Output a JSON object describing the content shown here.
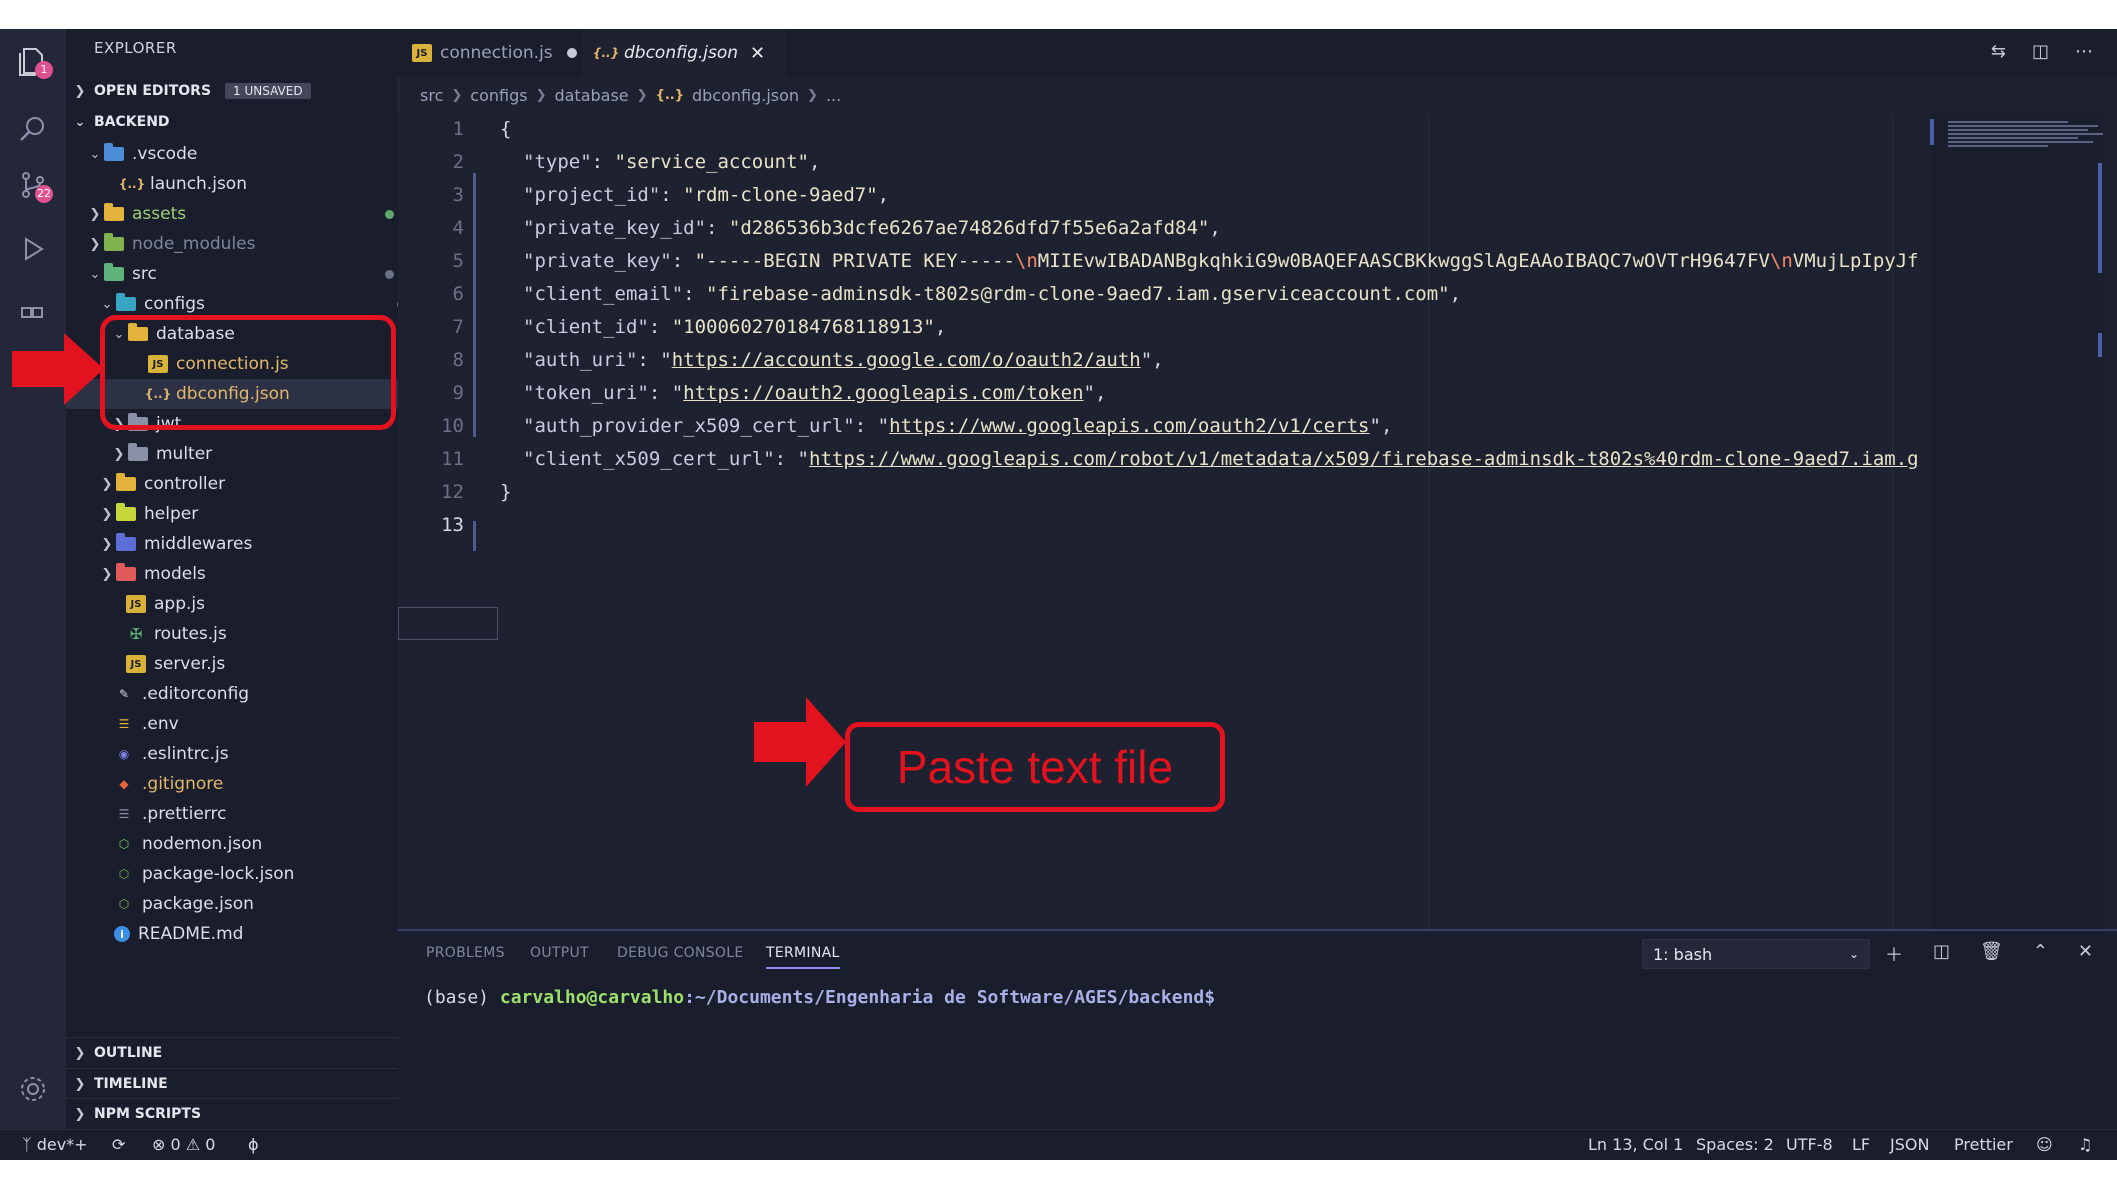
{
  "explorer": {
    "title": "EXPLORER",
    "open_editors": "OPEN EDITORS",
    "unsaved_badge": "1 UNSAVED",
    "project": "BACKEND",
    "tree": [
      {
        "label": "vscode_item",
        "text": ".vscode"
      },
      {
        "text": "launch.json"
      },
      {
        "text": "assets"
      },
      {
        "text": "node_modules"
      },
      {
        "text": "src"
      },
      {
        "text": "configs"
      },
      {
        "text": "database"
      },
      {
        "text": "connection.js"
      },
      {
        "text": "dbconfig.json"
      },
      {
        "text": "jwt"
      },
      {
        "text": "multer"
      },
      {
        "text": "controller"
      },
      {
        "text": "helper"
      },
      {
        "text": "middlewares"
      },
      {
        "text": "models"
      },
      {
        "text": "app.js"
      },
      {
        "text": "routes.js"
      },
      {
        "text": "server.js"
      },
      {
        "text": ".editorconfig"
      },
      {
        "text": ".env"
      },
      {
        "text": ".eslintrc.js"
      },
      {
        "text": ".gitignore"
      },
      {
        "text": ".prettierrc"
      },
      {
        "text": "nodemon.json"
      },
      {
        "text": "package-lock.json"
      },
      {
        "text": "package.json"
      },
      {
        "text": "README.md"
      }
    ],
    "modified_marker": "M",
    "outline": "OUTLINE",
    "timeline": "TIMELINE",
    "npm_scripts": "NPM SCRIPTS"
  },
  "activity": {
    "explorer_badge": "1",
    "scm_badge": "22"
  },
  "tabs": [
    {
      "label": "connection.js"
    },
    {
      "label": "dbconfig.json"
    }
  ],
  "breadcrumb": [
    "src",
    "configs",
    "database",
    "dbconfig.json",
    "..."
  ],
  "editor": {
    "line_numbers": [
      "1",
      "2",
      "3",
      "4",
      "5",
      "6",
      "7",
      "8",
      "9",
      "10",
      "11",
      "12",
      "13"
    ],
    "lines": {
      "l1": "{",
      "l2k": "\"type\"",
      "l2v": "\"service_account\"",
      "l3k": "\"project_id\"",
      "l3v": "\"rdm-clone-9aed7\"",
      "l4k": "\"private_key_id\"",
      "l4v": "\"d286536b3dcfe6267ae74826dfd7f55e6a2afd84\"",
      "l5k": "\"private_key\"",
      "l5a": "\"-----BEGIN PRIVATE KEY-----",
      "l5e1": "\\n",
      "l5b": "MIIEvwIBADANBgkqhkiG9w0BAQEFAASCBKkwggSlAgEAAoIBAQC7wOVTrH9647FV",
      "l5e2": "\\n",
      "l5c": "VMujLpIpyJf",
      "l6k": "\"client_email\"",
      "l6v": "\"firebase-adminsdk-t802s@rdm-clone-9aed7.iam.gserviceaccount.com\"",
      "l7k": "\"client_id\"",
      "l7v": "\"100060270184768118913\"",
      "l8k": "\"auth_uri\"",
      "l8v": "https://accounts.google.com/o/oauth2/auth",
      "l9k": "\"token_uri\"",
      "l9v": "https://oauth2.googleapis.com/token",
      "l10k": "\"auth_provider_x509_cert_url\"",
      "l10v": "https://www.googleapis.com/oauth2/v1/certs",
      "l11k": "\"client_x509_cert_url\"",
      "l11v": "https://www.googleapis.com/robot/v1/metadata/x509/firebase-adminsdk-t802s%40rdm-clone-9aed7.iam.g",
      "l12": "}"
    }
  },
  "panel": {
    "tabs": [
      "PROBLEMS",
      "OUTPUT",
      "DEBUG CONSOLE",
      "TERMINAL"
    ],
    "terminal_select": "1: bash",
    "prompt_env": "(base) ",
    "prompt_user": "carvalho@carvalho",
    "prompt_path": ":~/Documents/Engenharia de Software/AGES/backend$"
  },
  "statusbar": {
    "branch": "dev*+",
    "errors": "0",
    "warnings": "0",
    "position": "Ln 13, Col 1",
    "spaces": "Spaces: 2",
    "encoding": "UTF-8",
    "eol": "LF",
    "language": "JSON",
    "formatter": "Prettier"
  },
  "annotation": {
    "label": "Paste text file",
    "color": "#e3121f"
  }
}
